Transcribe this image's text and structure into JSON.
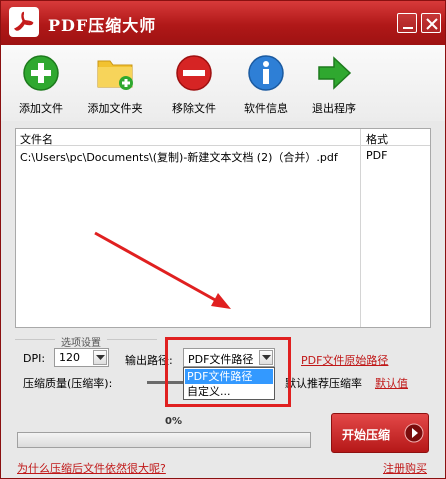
{
  "window": {
    "title": "PDF压缩大师"
  },
  "toolbar": {
    "items": [
      {
        "label": "添加文件",
        "icon": "add-file-icon"
      },
      {
        "label": "添加文件夹",
        "icon": "add-folder-icon"
      },
      {
        "label": "移除文件",
        "icon": "remove-file-icon"
      },
      {
        "label": "软件信息",
        "icon": "info-icon"
      },
      {
        "label": "退出程序",
        "icon": "exit-arrow-icon"
      }
    ]
  },
  "file_list": {
    "columns": [
      "文件名",
      "格式"
    ],
    "rows": [
      {
        "name": "C:\\Users\\pc\\Documents\\(复制)-新建文本文档 (2)（合并）.pdf",
        "format": "PDF"
      }
    ]
  },
  "options": {
    "group_title": "选项设置",
    "dpi_label": "DPI:",
    "dpi_value": "120",
    "output_path_label": "输出路径:",
    "output_path_value": "PDF文件路径",
    "output_path_options": [
      "PDF文件路径",
      "自定义..."
    ],
    "pdf_original_path_link": "PDF文件原始路径",
    "quality_label": "压缩质量(压缩率):",
    "recommend_text": "默认推荐压缩率",
    "default_link": "默认值"
  },
  "progress": {
    "percent_text": "0%",
    "value": 0
  },
  "start_button": {
    "label": "开始压缩"
  },
  "links": {
    "why_large": "为什么压缩后文件依然很大呢?",
    "register": "注册购买"
  },
  "colors": {
    "brand_red": "#c01818",
    "title_bar": "#b01818",
    "selection_blue": "#3399ff",
    "annotation_red": "#e02020"
  }
}
